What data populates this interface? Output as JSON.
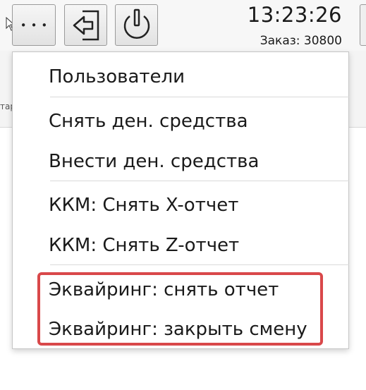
{
  "toolbar": {
    "more_label": "•••",
    "logout_icon": "logout-icon",
    "power_icon": "power-icon"
  },
  "status": {
    "time": "13:23:26",
    "order": "Заказ: 30800"
  },
  "background": {
    "strip_text": "тар"
  },
  "menu": {
    "items": [
      {
        "label": "Пользователи"
      },
      {
        "label": "Снять ден. средства"
      },
      {
        "label": "Внести ден. средства"
      },
      {
        "label": "ККМ: Снять X-отчет"
      },
      {
        "label": "ККМ: Снять Z-отчет"
      },
      {
        "label": "Эквайринг: снять отчет"
      },
      {
        "label": "Эквайринг: закрыть смену"
      }
    ]
  },
  "colors": {
    "highlight": "#d9484a",
    "menu_border": "#c6c6c6"
  }
}
